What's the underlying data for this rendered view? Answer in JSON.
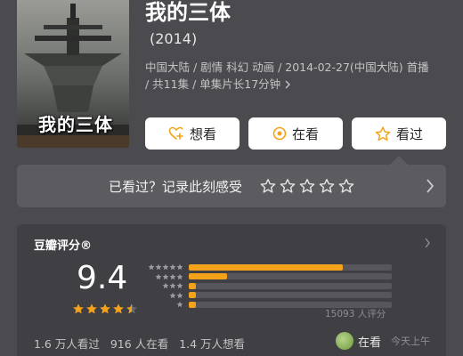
{
  "poster": {
    "overlay_title": "我的三体"
  },
  "title": "我的三体",
  "year": "(2014)",
  "meta": {
    "line1": "中国大陆 / 剧情 科幻 动画 / 2014-02-27(中国大陆) 首播",
    "line2": "/ 共11集 / 单集片长17分钟",
    "more_icon": "chevron-right-icon"
  },
  "actions": {
    "want": {
      "label": "想看",
      "icon": "heart-plus-icon"
    },
    "doing": {
      "label": "在看",
      "icon": "target-icon"
    },
    "done": {
      "label": "看过",
      "icon": "star-outline-icon"
    }
  },
  "rate_prompt": {
    "text": "已看过？记录此刻感受",
    "star_count": 5
  },
  "rating": {
    "heading": "豆瓣评分®",
    "score": "9.4",
    "stars_filled": 4.5,
    "distribution": [
      0.76,
      0.19,
      0.03,
      0.01,
      0.01
    ],
    "count_text": "15093 人评分"
  },
  "stats": {
    "watched": "1.6 万人看过",
    "watching": "916 人在看",
    "wanting": "1.4 万人想看"
  },
  "friend": {
    "status": "在看",
    "time": "今天上午"
  },
  "colors": {
    "accent": "#f4a21a",
    "background": "#4a4a4f"
  }
}
